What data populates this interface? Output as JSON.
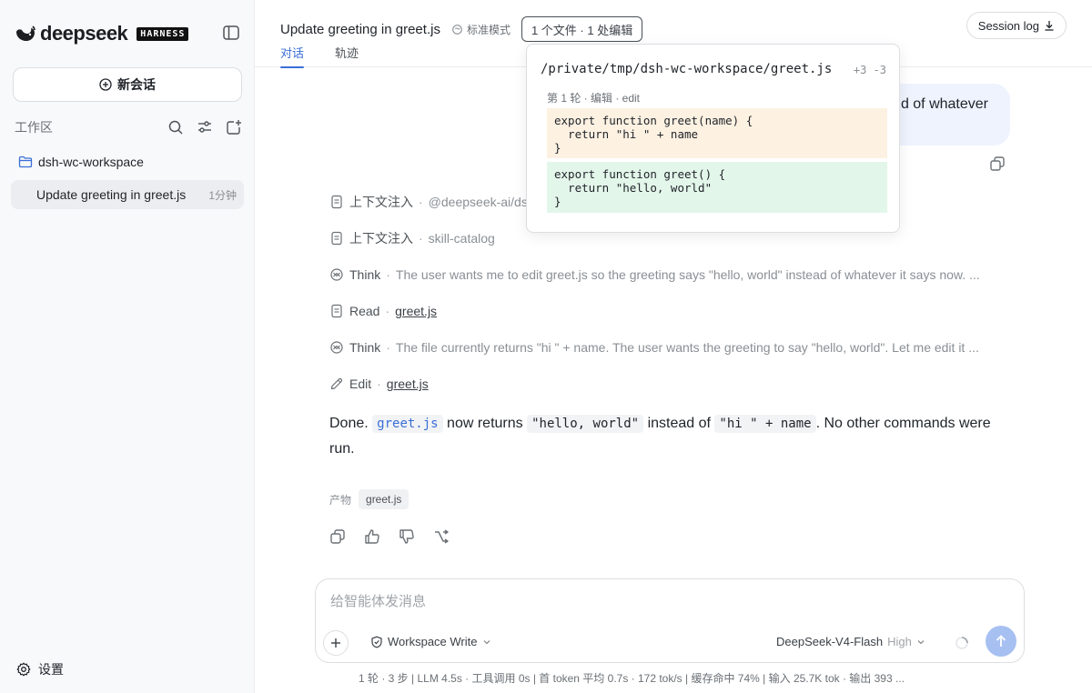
{
  "sidebar": {
    "logo_text": "deepseek",
    "logo_badge": "HARNESS",
    "new_chat_label": "新会话",
    "workspace_label": "工作区",
    "folder_name": "dsh-wc-workspace",
    "sessions": [
      {
        "title": "Update greeting in greet.js",
        "time": "1分钟"
      }
    ],
    "settings_label": "设置"
  },
  "header": {
    "title": "Update greeting in greet.js",
    "mode": "标准模式",
    "files_summary": "1 个文件 · 1 处编辑",
    "session_log": "Session log",
    "tabs": [
      {
        "label": "对话",
        "active": true
      },
      {
        "label": "轨迹",
        "active": false
      }
    ]
  },
  "chat": {
    "user_message": "d of whatever",
    "tool_rows": [
      {
        "icon": "document-icon",
        "name": "上下文注入",
        "detail": "@deepseek-ai/ds",
        "link": false
      },
      {
        "icon": "document-icon",
        "name": "上下文注入",
        "detail": "skill-catalog",
        "link": false
      },
      {
        "icon": "brain-icon",
        "name": "Think",
        "detail": "The user wants me to edit greet.js so the greeting says \"hello, world\" instead of whatever it says now. ...",
        "link": false
      },
      {
        "icon": "document-icon",
        "name": "Read",
        "detail": "greet.js",
        "link": true
      },
      {
        "icon": "brain-icon",
        "name": "Think",
        "detail": "The file currently returns \"hi \" + name. The user wants the greeting to say \"hello, world\". Let me edit it ...",
        "link": false
      },
      {
        "icon": "pencil-icon",
        "name": "Edit",
        "detail": "greet.js",
        "link": true
      }
    ],
    "answer": {
      "p1": "Done.",
      "c1": "greet.js",
      "p2": "now returns",
      "c2": "\"hello, world\"",
      "p3": "instead of",
      "c3": "\"hi \" + name",
      "p4": ". No other commands were run."
    },
    "artifacts_label": "产物",
    "artifact": "greet.js"
  },
  "composer": {
    "placeholder": "给智能体发消息",
    "permission": "Workspace Write",
    "model": "DeepSeek-V4-Flash",
    "model_level": "High",
    "stats": "1 轮 · 3 步   |   LLM 4.5s · 工具调用 0s   |   首 token 平均 0.7s · 172 tok/s   |   缓存命中 74%   |   输入 25.7K tok · 输出 393 ..."
  },
  "popover": {
    "path": "/private/tmp/dsh-wc-workspace/greet.js",
    "diff_stats": "+3 -3",
    "round_label": "第 1 轮 · 编辑 · edit",
    "old_code": "export function greet(name) {\n  return \"hi \" + name\n}",
    "new_code": "export function greet() {\n  return \"hello, world\"\n}"
  },
  "colors": {
    "accent": "#3a6fd8",
    "user_bubble": "#eef3fe",
    "diff_removed": "#fdf1e2",
    "diff_added": "#e3f6ea",
    "send_button": "#a7c0f2"
  }
}
